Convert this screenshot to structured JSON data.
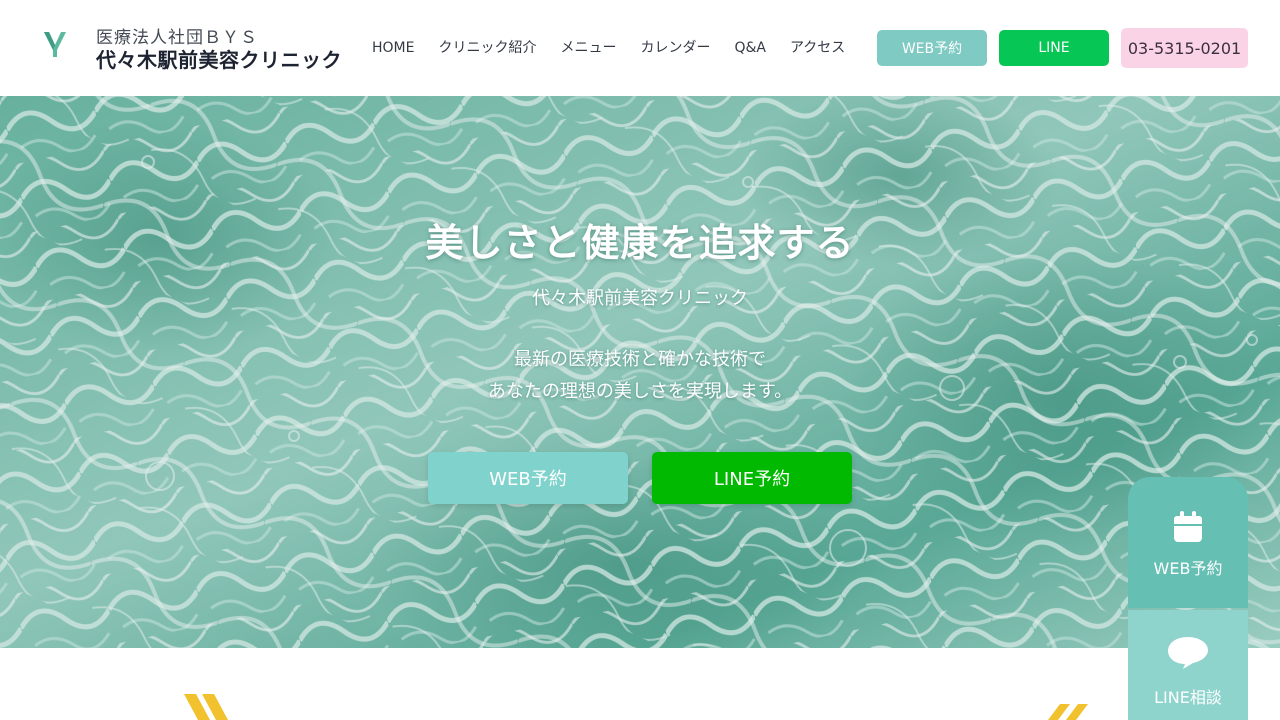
{
  "header": {
    "org": "医療法人社団ＢＹＳ",
    "clinic_name": "代々木駅前美容クリニック",
    "nav": [
      "HOME",
      "クリニック紹介",
      "メニュー",
      "カレンダー",
      "Q&A",
      "アクセス"
    ],
    "web_button": "WEB予約",
    "line_button": "LINE",
    "phone": "03-5315-0201"
  },
  "hero": {
    "title": "美しさと健康を追求する",
    "subtitle": "代々木駅前美容クリニック",
    "description_line1": "最新の医療技術と確かな技術で",
    "description_line2": "あなたの理想の美しさを実現します。",
    "cta_web": "WEB予約",
    "cta_line": "LINE予約"
  },
  "floating": {
    "web_label": "WEB予約",
    "line_label": "LINE相談"
  },
  "colors": {
    "accent_teal": "#7fcac3",
    "line_green": "#06c755",
    "phone_pink": "#fbd3e6",
    "float_teal": "#66bfb3",
    "deco_yellow": "#f2c12e"
  },
  "icons": {
    "logo": "clinic-logo-icon",
    "web": "calendar-icon",
    "line": "speech-bubble-icon"
  }
}
